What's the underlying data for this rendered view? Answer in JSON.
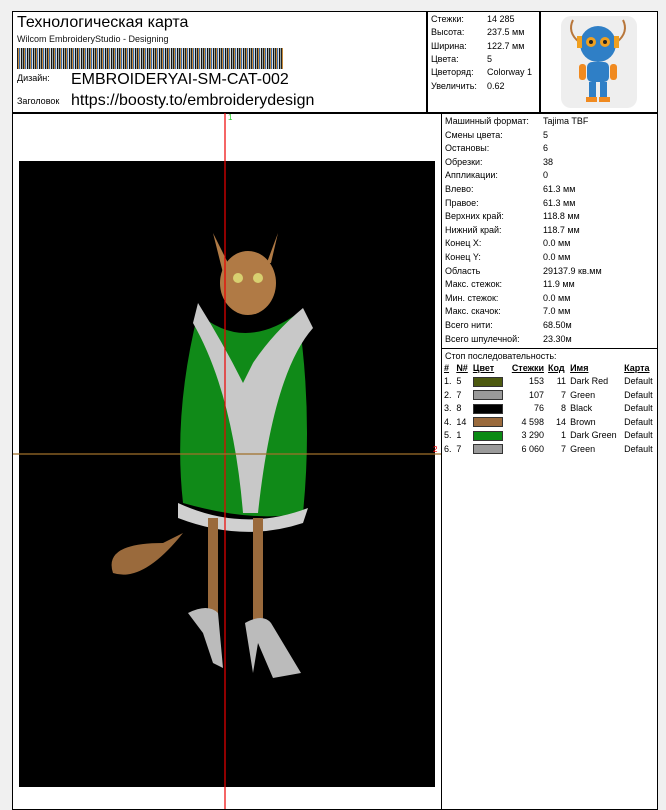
{
  "header": {
    "title": "Технологическая карта",
    "software": "Wilcom EmbroideryStudio - Designing",
    "design_label": "Дизайн:",
    "design_value": "EMBROIDERYAI-SM-CAT-002",
    "heading_label": "Заголовок",
    "heading_value": "https://boosty.to/embroiderydesign"
  },
  "stats": [
    {
      "k": "Стежки:",
      "v": "14 285"
    },
    {
      "k": "Высота:",
      "v": "237.5 мм"
    },
    {
      "k": "Ширина:",
      "v": "122.7 мм"
    },
    {
      "k": "Цвета:",
      "v": "5"
    },
    {
      "k": "Цветоряд:",
      "v": "Colorway 1"
    },
    {
      "k": "Увеличить:",
      "v": "0.62"
    }
  ],
  "info": [
    {
      "k": "Машинный формат:",
      "v": "Tajima TBF"
    },
    {
      "k": "Смены цвета:",
      "v": "5"
    },
    {
      "k": "Остановы:",
      "v": "6"
    },
    {
      "k": "Обрезки:",
      "v": "38"
    },
    {
      "k": "Аппликации:",
      "v": "0"
    },
    {
      "k": "Влево:",
      "v": "61.3 мм"
    },
    {
      "k": "Правое:",
      "v": "61.3 мм"
    },
    {
      "k": "Верхних край:",
      "v": "118.8 мм"
    },
    {
      "k": "Нижний край:",
      "v": "118.7 мм"
    },
    {
      "k": "Конец X:",
      "v": "0.0 мм"
    },
    {
      "k": "Конец Y:",
      "v": "0.0 мм"
    },
    {
      "k": "Область",
      "v": "29137.9 кв.мм"
    },
    {
      "k": "Макс. стежок:",
      "v": "11.9 мм"
    },
    {
      "k": "Мин. стежок:",
      "v": "0.0 мм"
    },
    {
      "k": "Макс. скачок:",
      "v": "7.0 мм"
    },
    {
      "k": "Всего нити:",
      "v": "68.50м"
    },
    {
      "k": "Всего шпулечной:",
      "v": "23.30м"
    }
  ],
  "stop_sequence": {
    "title": "Стоп последовательность:",
    "headers": [
      "#",
      "N#",
      "Цвет",
      "Стежки",
      "Код",
      "Имя",
      "Карта"
    ],
    "rows": [
      {
        "n": "1.",
        "num": "5",
        "color": "#4d5a10",
        "stitches": "153",
        "code": "11",
        "name": "Dark Red",
        "chart": "Default"
      },
      {
        "n": "2.",
        "num": "7",
        "color": "#9a9a9a",
        "stitches": "107",
        "code": "7",
        "name": "Green",
        "chart": "Default"
      },
      {
        "n": "3.",
        "num": "8",
        "color": "#000000",
        "stitches": "76",
        "code": "8",
        "name": "Black",
        "chart": "Default"
      },
      {
        "n": "4.",
        "num": "14",
        "color": "#9a6a3c",
        "stitches": "4 598",
        "code": "14",
        "name": "Brown",
        "chart": "Default"
      },
      {
        "n": "5.",
        "num": "1",
        "color": "#0a8a14",
        "stitches": "3 290",
        "code": "1",
        "name": "Dark Green",
        "chart": "Default"
      },
      {
        "n": "6.",
        "num": "7",
        "color": "#9a9a9a",
        "stitches": "6 060",
        "code": "7",
        "name": "Green",
        "chart": "Default"
      }
    ]
  },
  "axes": {
    "v_label": "1",
    "h_label": "2"
  }
}
